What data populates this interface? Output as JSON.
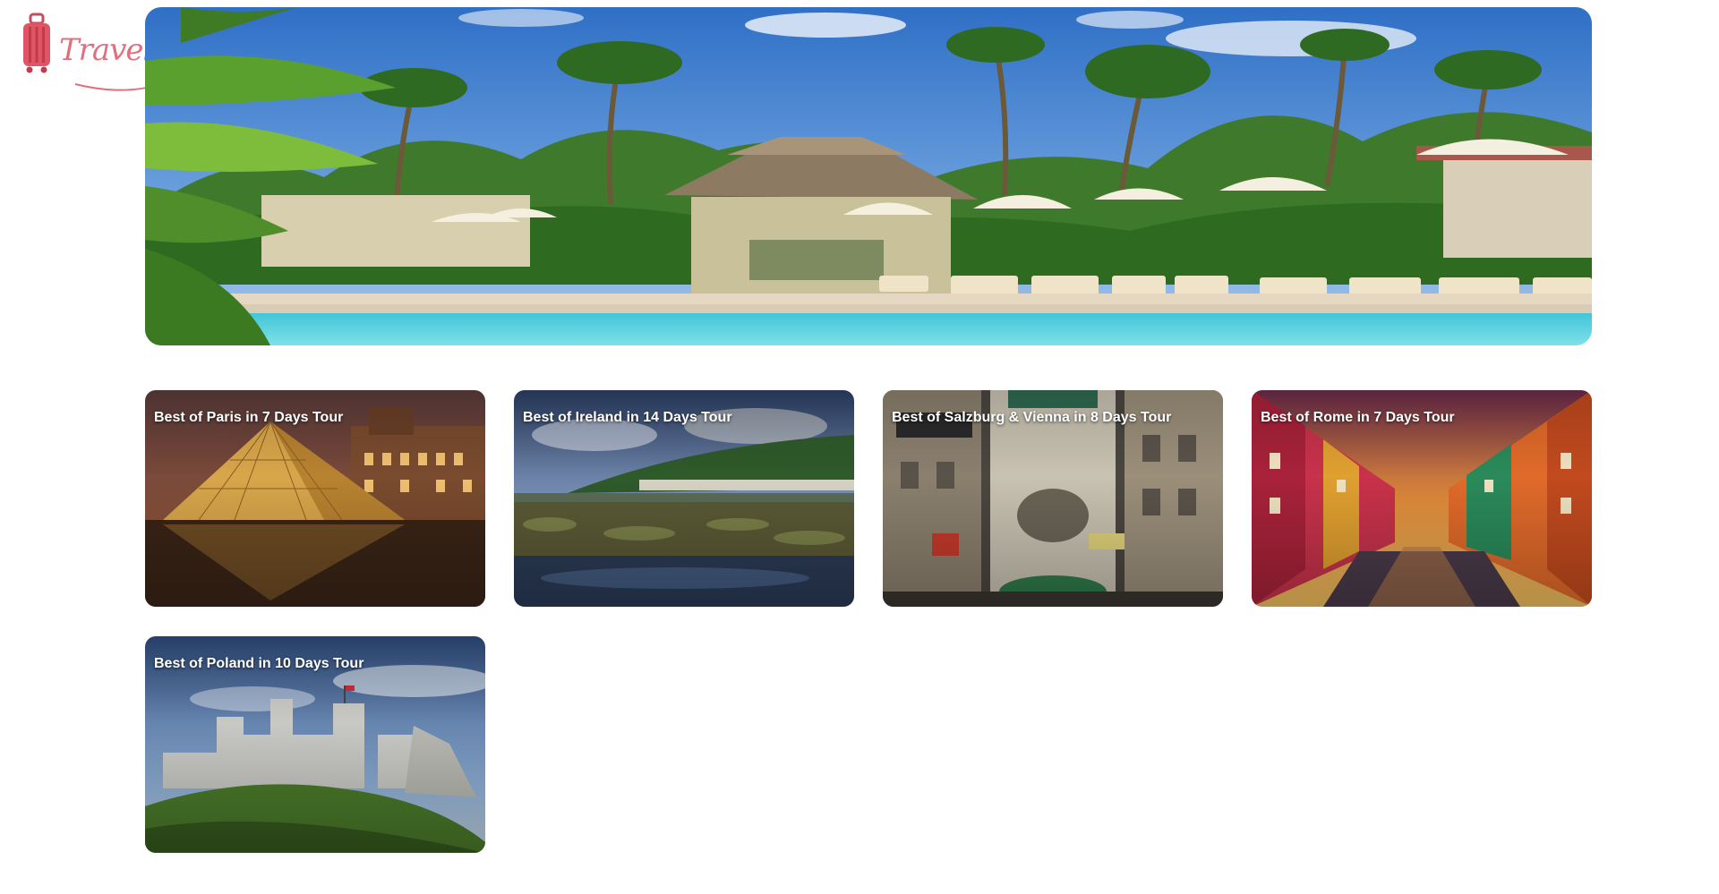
{
  "brand": {
    "name": "Travellusion",
    "logo_icon": "suitcase-icon",
    "color": "#e07080"
  },
  "hero": {
    "image": "tropical-resort-pool-hero-image"
  },
  "tours": [
    {
      "title": "Best of Paris in 7 Days Tour",
      "image": "louvre-pyramid-night-image"
    },
    {
      "title": "Best of Ireland in 14 Days Tour",
      "image": "ireland-coast-lake-image"
    },
    {
      "title": "Best of Salzburg & Vienna in 8 Days Tour",
      "image": "vienna-street-image"
    },
    {
      "title": "Best of Rome in 7 Days Tour",
      "image": "colorful-canal-sunset-image"
    },
    {
      "title": "Best of Poland in 10 Days Tour",
      "image": "castle-ruins-hill-image"
    }
  ]
}
